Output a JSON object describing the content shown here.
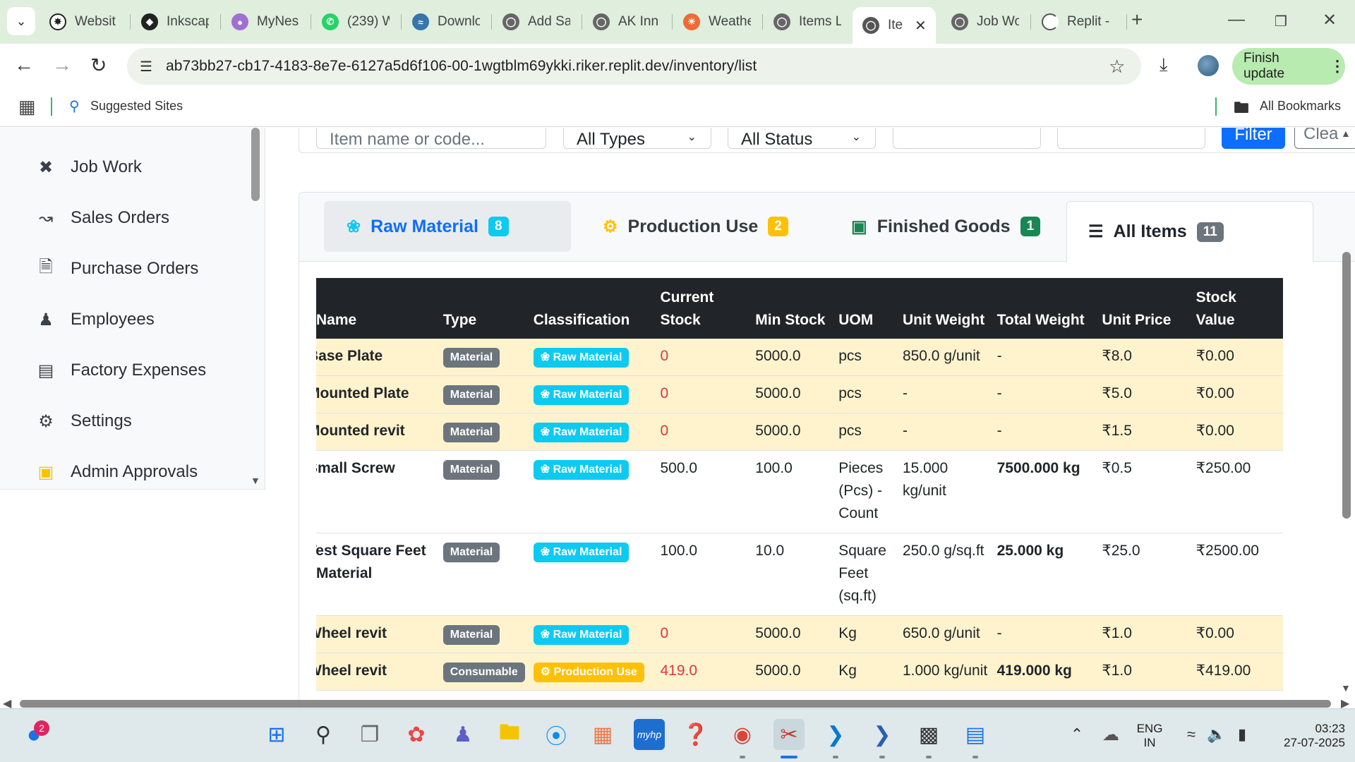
{
  "browser": {
    "tabs": [
      {
        "label": "Websit",
        "icon": "openai-icon",
        "color": "#222222"
      },
      {
        "label": "Inkscap",
        "icon": "inkscape-icon",
        "color": "#222222"
      },
      {
        "label": "MyNes",
        "icon": "mynes-icon",
        "color": "#a070d0"
      },
      {
        "label": "(239) W",
        "icon": "whatsapp-icon",
        "color": "#25d366"
      },
      {
        "label": "Downlo",
        "icon": "python-icon",
        "color": "#3776ab"
      },
      {
        "label": "Add Sa",
        "icon": "globe-icon",
        "color": "#555555"
      },
      {
        "label": "AK Inn",
        "icon": "globe-icon",
        "color": "#555555"
      },
      {
        "label": "Weathe",
        "icon": "weather-icon",
        "color": "#f06a35"
      },
      {
        "label": "Items L",
        "icon": "globe-icon",
        "color": "#555555"
      },
      {
        "label": "Ite",
        "icon": "globe-icon",
        "color": "#555555"
      },
      {
        "label": "Job Wo",
        "icon": "globe-icon",
        "color": "#555555"
      },
      {
        "label": "Replit -",
        "icon": "loading-icon",
        "color": "#555555"
      }
    ],
    "url": "ab73bb27-cb17-4183-8e7e-6127a5d6f106-00-1wgtblm69ykki.riker.replit.dev/inventory/list",
    "finish_update": "Finish update",
    "suggested_sites": "Suggested Sites",
    "all_bookmarks": "All Bookmarks"
  },
  "sidebar": {
    "items": [
      {
        "label": "Job Work",
        "icon": "tools-icon"
      },
      {
        "label": "Sales Orders",
        "icon": "chart-line-icon"
      },
      {
        "label": "Purchase Orders",
        "icon": "file-invoice-icon"
      },
      {
        "label": "Employees",
        "icon": "users-icon"
      },
      {
        "label": "Factory Expenses",
        "icon": "receipt-icon"
      },
      {
        "label": "Settings",
        "icon": "gear-icon"
      },
      {
        "label": "Admin Approvals",
        "icon": "clipboard-check-icon"
      }
    ]
  },
  "filters": {
    "search_placeholder": "Item name or code...",
    "type_select": "All Types",
    "status_select": "All Status",
    "filter_button": "Filter",
    "clear_button": "Clea"
  },
  "category_tabs": [
    {
      "label": "Raw Material",
      "count": "8",
      "badge_color": "#0dcaf0",
      "icon": "cubes-icon"
    },
    {
      "label": "Production Use",
      "count": "2",
      "badge_color": "#ffc107",
      "icon": "cogs-icon"
    },
    {
      "label": "Finished Goods",
      "count": "1",
      "badge_color": "#198754",
      "icon": "box-icon"
    },
    {
      "label": "All Items",
      "count": "11",
      "badge_color": "#6c757d",
      "icon": "list-icon"
    }
  ],
  "table": {
    "headers": {
      "name": "Name",
      "type": "Type",
      "classification": "Classification",
      "current_stock_1": "Current",
      "current_stock_2": "Stock",
      "min_stock": "Min Stock",
      "uom": "UOM",
      "unit_weight": "Unit Weight",
      "total_weight": "Total Weight",
      "unit_price": "Unit Price",
      "stock_value": "Stock Value"
    },
    "rows": [
      {
        "name": "Base Plate",
        "type": "Material",
        "classification": "Raw Material",
        "current_stock": "0",
        "min_stock": "5000.0",
        "uom": "pcs",
        "unit_weight": "850.0 g/unit",
        "total_weight": "-",
        "unit_price": "₹8.0",
        "stock_value": "₹0.00"
      },
      {
        "name": "Mounted Plate",
        "type": "Material",
        "classification": "Raw Material",
        "current_stock": "0",
        "min_stock": "5000.0",
        "uom": "pcs",
        "unit_weight": "-",
        "total_weight": "-",
        "unit_price": "₹5.0",
        "stock_value": "₹0.00"
      },
      {
        "name": "Mounted revit",
        "type": "Material",
        "classification": "Raw Material",
        "current_stock": "0",
        "min_stock": "5000.0",
        "uom": "pcs",
        "unit_weight": "-",
        "total_weight": "-",
        "unit_price": "₹1.5",
        "stock_value": "₹0.00"
      },
      {
        "name": "Small Screw",
        "type": "Material",
        "classification": "Raw Material",
        "current_stock": "500.0",
        "min_stock": "100.0",
        "uom": "Pieces (Pcs) - Count",
        "unit_weight": "15.000 kg/unit",
        "total_weight": "7500.000 kg",
        "unit_price": "₹0.5",
        "stock_value": "₹250.00"
      },
      {
        "name": "Test Square Feet Material",
        "type": "Material",
        "classification": "Raw Material",
        "current_stock": "100.0",
        "min_stock": "10.0",
        "uom": "Square Feet (sq.ft)",
        "unit_weight": "250.0 g/sq.ft",
        "total_weight": "25.000 kg",
        "unit_price": "₹25.0",
        "stock_value": "₹2500.00"
      },
      {
        "name": "Wheel revit",
        "type": "Material",
        "classification": "Raw Material",
        "current_stock": "0",
        "min_stock": "5000.0",
        "uom": "Kg",
        "unit_weight": "650.0 g/unit",
        "total_weight": "-",
        "unit_price": "₹1.0",
        "stock_value": "₹0.00"
      },
      {
        "name": "Wheel revit",
        "type": "Consumable",
        "classification": "Production Use",
        "current_stock": "419.0",
        "min_stock": "5000.0",
        "uom": "Kg",
        "unit_weight": "1.000 kg/unit",
        "total_weight": "419.000 kg",
        "unit_price": "₹1.0",
        "stock_value": "₹419.00"
      }
    ]
  },
  "taskbar": {
    "notification_count": "2",
    "lang_1": "ENG",
    "lang_2": "IN",
    "time": "03:23",
    "date": "27-07-2025"
  }
}
